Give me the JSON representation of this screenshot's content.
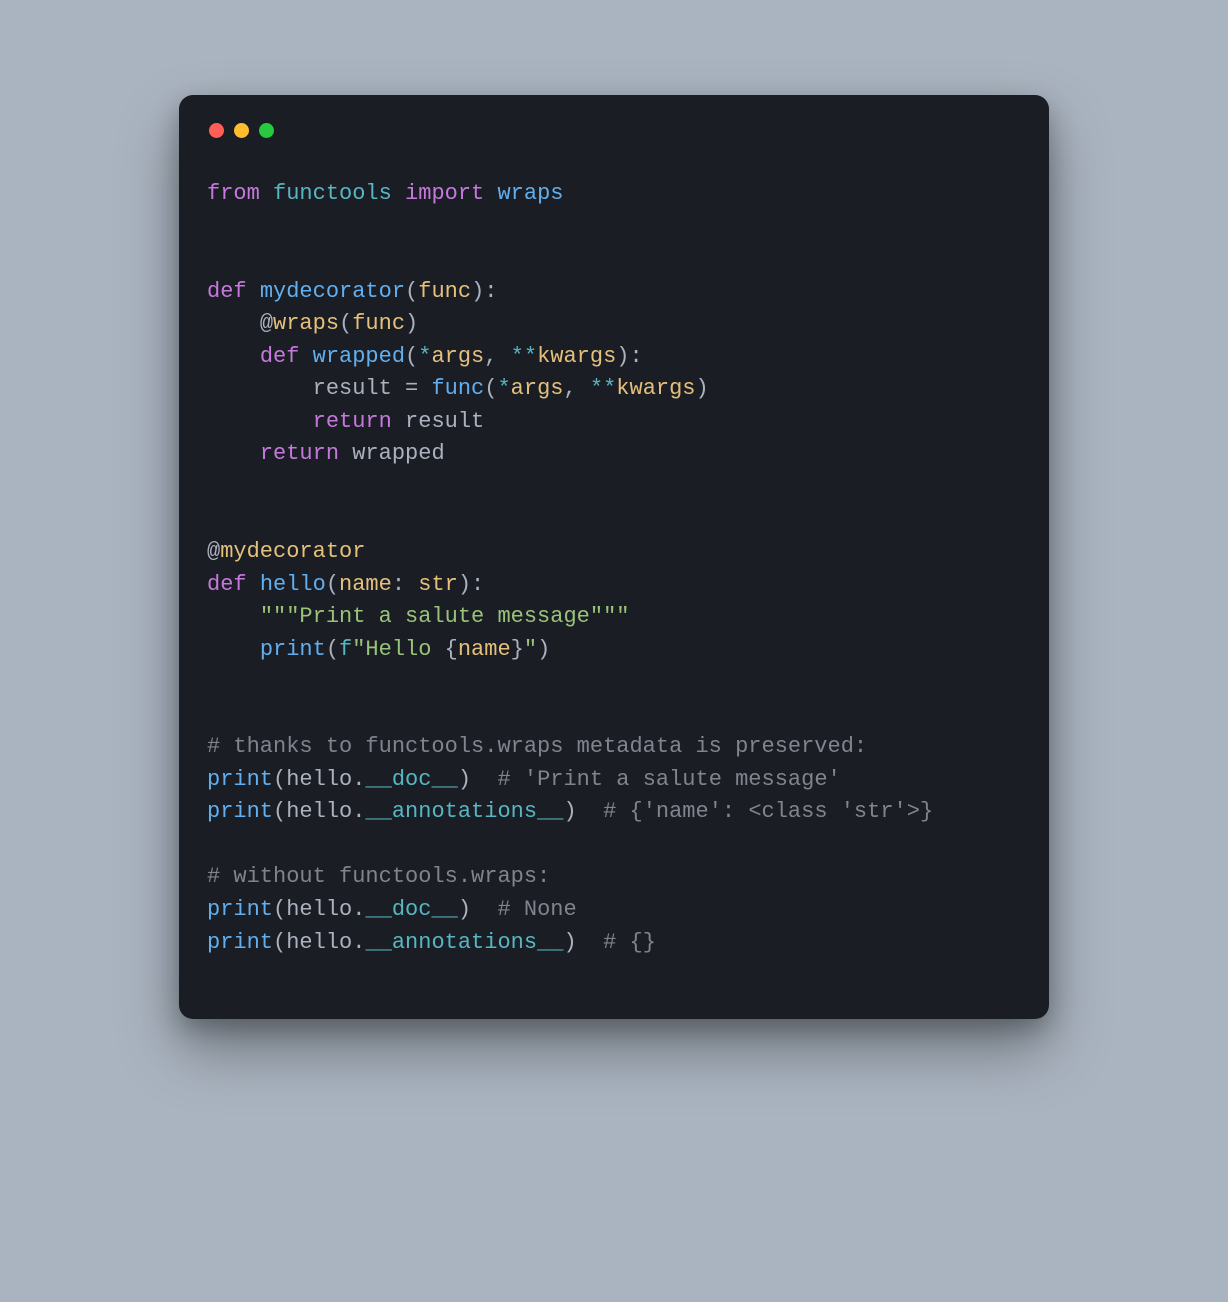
{
  "traffic_lights": {
    "close": "red",
    "minimize": "yellow",
    "zoom": "green"
  },
  "colors": {
    "bg_page": "#aab4c0",
    "bg_window": "#1a1d24",
    "keyword": "#c678dd",
    "module": "#56b6c2",
    "function": "#61afef",
    "identifier": "#e5c07b",
    "string": "#98c379",
    "comment": "#7f848e",
    "punct": "#abb2bf"
  },
  "code": {
    "l1": {
      "kw_from": "from",
      "mod": "functools",
      "kw_import": "import",
      "name": "wraps"
    },
    "l4": {
      "kw_def": "def",
      "name": "mydecorator",
      "paren_o": "(",
      "arg": "func",
      "paren_c_colon": "):"
    },
    "l5": {
      "at": "@",
      "deco": "wraps",
      "paren_o": "(",
      "arg": "func",
      "paren_c": ")"
    },
    "l6": {
      "kw_def": "def",
      "name": "wrapped",
      "paren_o": "(",
      "star": "*",
      "args": "args",
      "comma": ", ",
      "dstar": "**",
      "kwargs": "kwargs",
      "paren_c_colon": "):"
    },
    "l7": {
      "result": "result",
      "eq": " = ",
      "call": "func",
      "paren_o": "(",
      "star": "*",
      "args": "args",
      "comma": ", ",
      "dstar": "**",
      "kwargs": "kwargs",
      "paren_c": ")"
    },
    "l8": {
      "kw_return": "return",
      "val": "result"
    },
    "l9": {
      "kw_return": "return",
      "val": "wrapped"
    },
    "l12": {
      "at": "@",
      "deco": "mydecorator"
    },
    "l13": {
      "kw_def": "def",
      "name": "hello",
      "paren_o": "(",
      "arg": "name",
      "colon": ": ",
      "type": "str",
      "paren_c_colon": "):"
    },
    "l14": {
      "doc": "\"\"\"Print a salute message\"\"\""
    },
    "l15": {
      "call": "print",
      "paren_o": "(",
      "fpre": "f",
      "s_open": "\"Hello ",
      "brace_o": "{",
      "var": "name",
      "brace_c": "}",
      "s_close": "\"",
      "paren_c": ")"
    },
    "l18": {
      "cmt": "# thanks to functools.wraps metadata is preserved:"
    },
    "l19": {
      "call": "print",
      "paren_o": "(",
      "obj": "hello",
      "dot": ".",
      "attr": "__doc__",
      "paren_c": ")",
      "cmt": "  # 'Print a salute message'"
    },
    "l20": {
      "call": "print",
      "paren_o": "(",
      "obj": "hello",
      "dot": ".",
      "attr": "__annotations__",
      "paren_c": ")",
      "cmt": "  # {'name': <class 'str'>}"
    },
    "l22": {
      "cmt": "# without functools.wraps:"
    },
    "l23": {
      "call": "print",
      "paren_o": "(",
      "obj": "hello",
      "dot": ".",
      "attr": "__doc__",
      "paren_c": ")",
      "cmt": "  # None"
    },
    "l24": {
      "call": "print",
      "paren_o": "(",
      "obj": "hello",
      "dot": ".",
      "attr": "__annotations__",
      "paren_c": ")",
      "cmt": "  # {}"
    }
  }
}
